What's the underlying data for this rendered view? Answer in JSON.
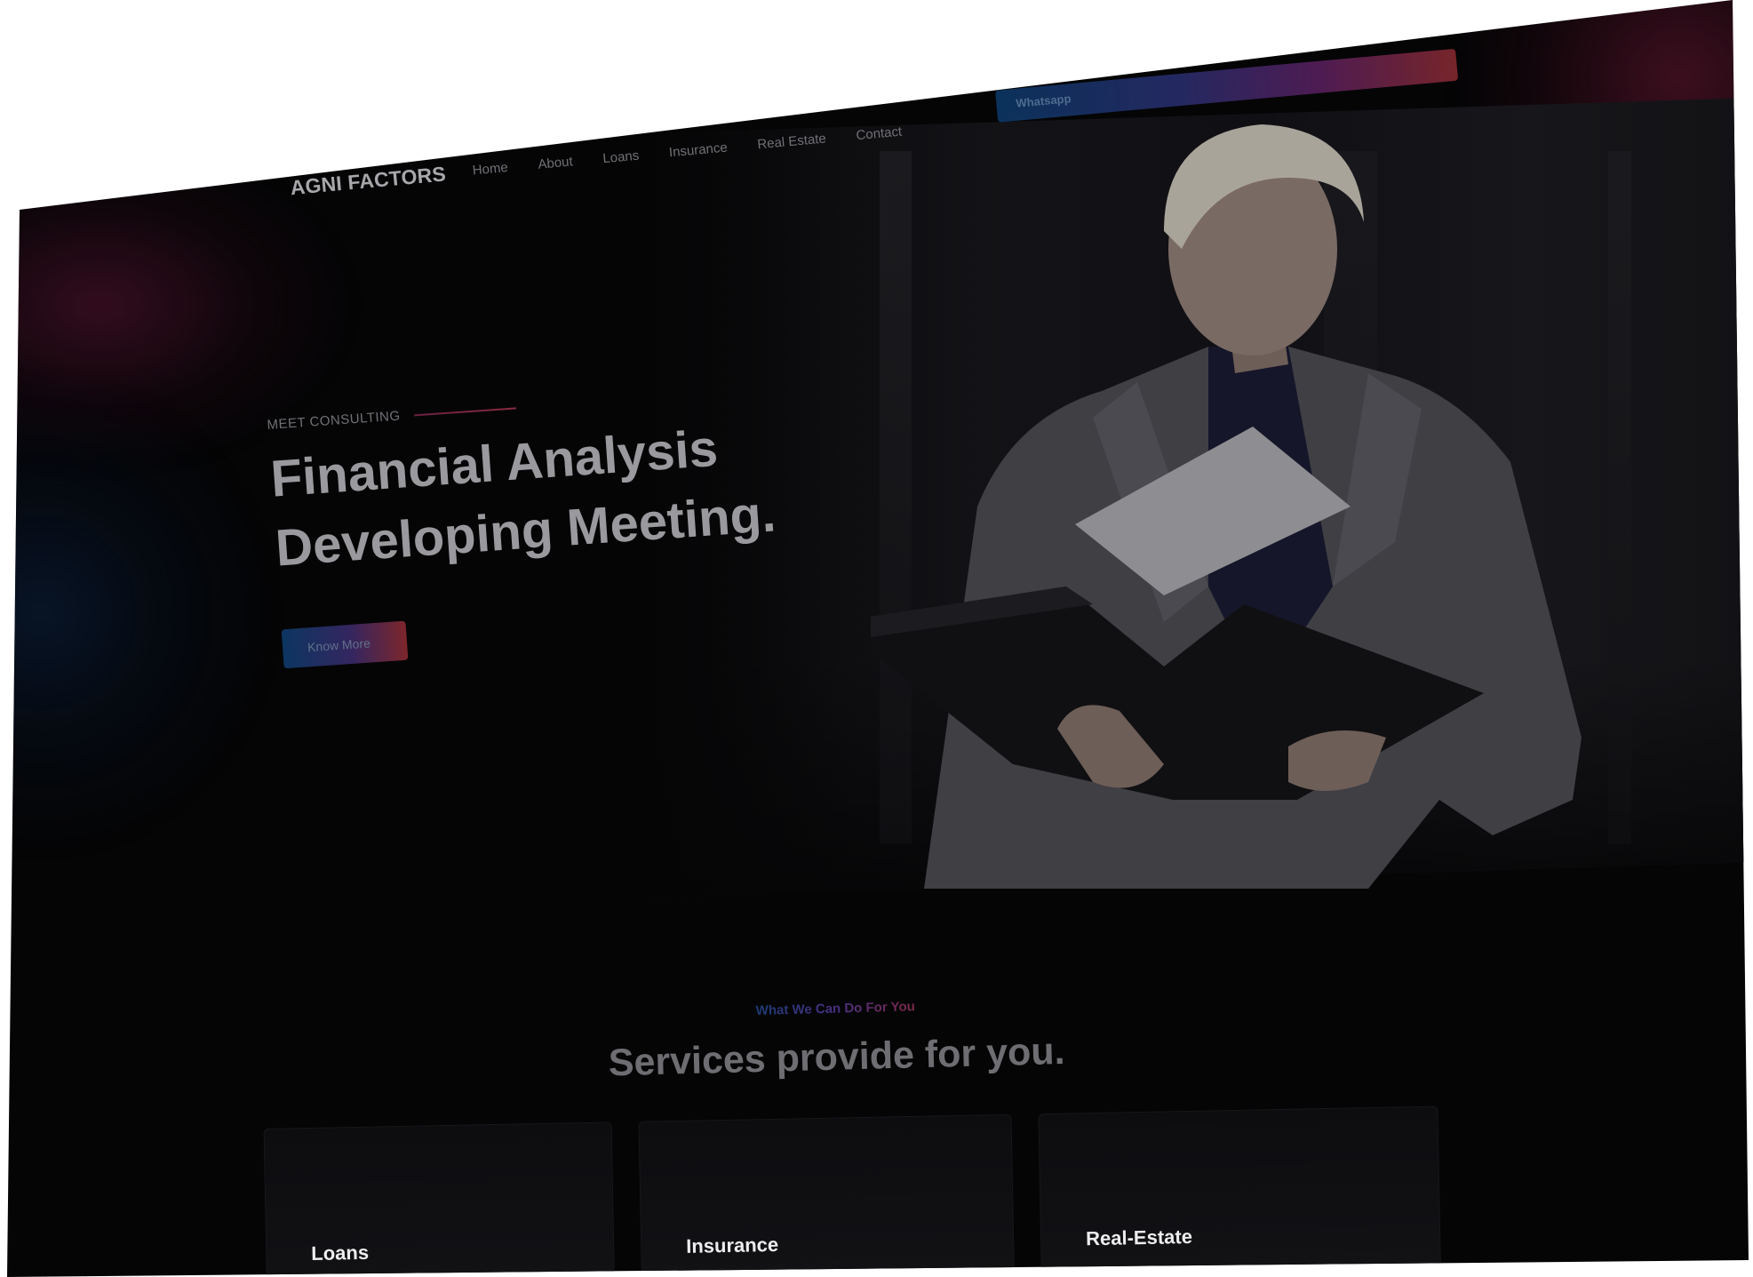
{
  "brand": {
    "logo_text": "AGNI FACTORS"
  },
  "nav": {
    "links": [
      "Home",
      "About",
      "Loans",
      "Insurance",
      "Real Estate",
      "Contact"
    ],
    "whatsapp_label": "Whatsapp"
  },
  "hero": {
    "eyebrow": "MEET CONSULTING",
    "title_line1": "Financial Analysis",
    "title_line2": "Developing Meeting.",
    "cta_label": "Know More"
  },
  "services": {
    "tag": "What We Can Do For You",
    "title": "Services provide for you.",
    "cards": [
      "Loans",
      "Insurance",
      "Real-Estate"
    ]
  },
  "colors": {
    "background": "#050506",
    "accent_blue": "#0d3b6b",
    "accent_red": "#8a2a30",
    "text_light": "#ededee"
  }
}
